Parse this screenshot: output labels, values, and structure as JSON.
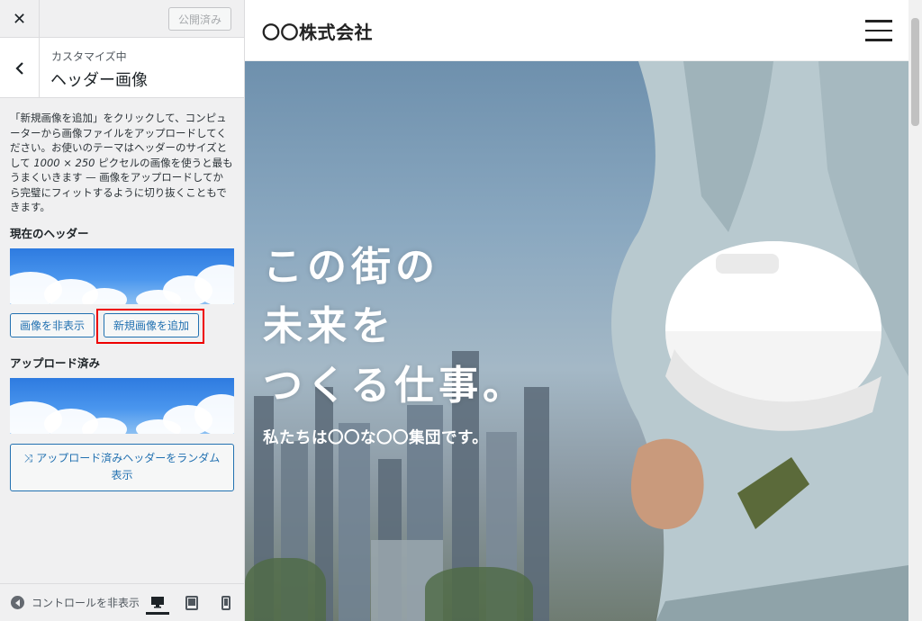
{
  "topbar": {
    "close_glyph": "✕",
    "publish_label": "公開済み"
  },
  "section": {
    "crumb": "カスタマイズ中",
    "title": "ヘッダー画像"
  },
  "panel": {
    "desc_1": "「新規画像を追加」をクリックして、コンピューターから画像ファイルをアップロードしてください。お使いのテーマはヘッダーのサイズとして ",
    "desc_size": "1000 × 250",
    "desc_2": " ピクセルの画像を使うと最もうまくいきます — 画像をアップロードしてから完璧にフィットするように切り抜くこともできます。",
    "current_label": "現在のヘッダー",
    "hide_button": "画像を非表示",
    "add_button": "新規画像を追加",
    "uploaded_label": "アップロード済み",
    "random_button": "アップロード済みヘッダーをランダム表示"
  },
  "footer": {
    "collapse_label": "コントロールを非表示"
  },
  "preview": {
    "site_title": "〇〇株式会社",
    "hero_line1": "この街の",
    "hero_line2": "未来を",
    "hero_line3": "つくる仕事。",
    "hero_sub": "私たちは〇〇な〇〇集団です。"
  },
  "colors": {
    "accent": "#2271b1",
    "highlight": "#e00000",
    "sidebar_bg": "#f0f0f1"
  },
  "icons": [
    "close-icon",
    "chevron-left-icon",
    "shuffle-icon",
    "collapse-arrow-icon",
    "desktop-icon",
    "tablet-icon",
    "mobile-icon",
    "hamburger-icon"
  ]
}
